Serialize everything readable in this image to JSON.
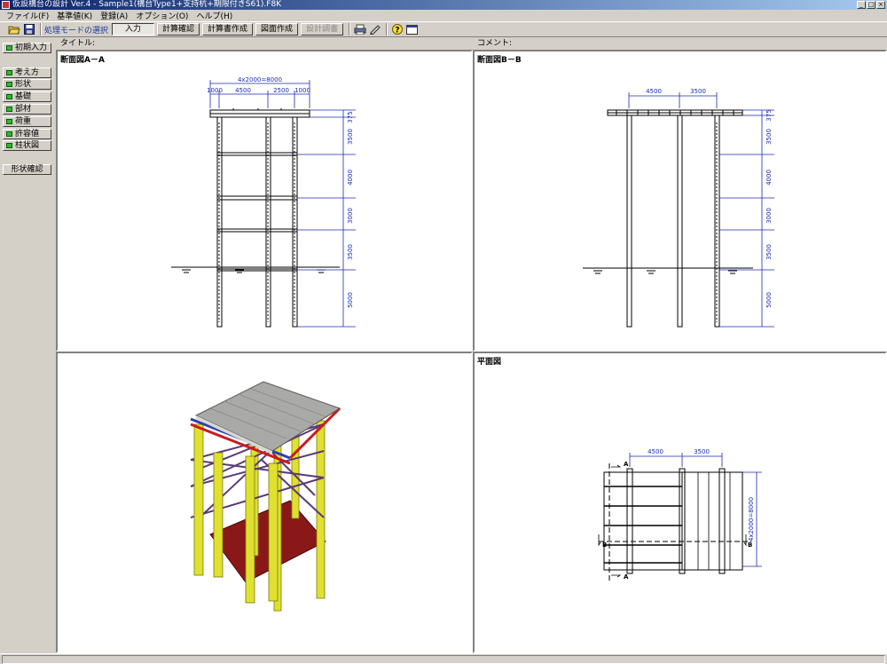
{
  "window": {
    "title": "仮設構台の設計 Ver.4 - Sample1(構台Type1+支持杭+期限付きS61).F8K"
  },
  "menu": [
    "ファイル(F)",
    "基準値(K)",
    "登録(A)",
    "オプション(O)",
    "ヘルプ(H)"
  ],
  "toolbar": {
    "mode_label": "処理モードの選択",
    "buttons": [
      "入力",
      "計算確認",
      "計算書作成",
      "図面作成",
      "設計調書"
    ],
    "active": "入力",
    "disabled": "設計調書"
  },
  "sidebar": {
    "top": "初期入力",
    "items": [
      "考え方",
      "形状",
      "基礎",
      "部材",
      "荷重",
      "許容値",
      "柱状図"
    ],
    "check": "形状確認"
  },
  "header": {
    "title_label": "タイトル:",
    "comment_label": "コメント:"
  },
  "panes": {
    "section_aa": {
      "label": "断面図A－A",
      "dims_top": {
        "total": "4x2000=8000",
        "parts": [
          "1000",
          "4500",
          "2500",
          "1000"
        ]
      },
      "dims_side": [
        "375",
        "3500",
        "4000",
        "3000",
        "3500",
        "5000"
      ]
    },
    "section_bb": {
      "label": "断面図B－B",
      "dims_top": [
        "4500",
        "3500"
      ],
      "dims_side": [
        "375",
        "3500",
        "4000",
        "3000",
        "3500",
        "5000"
      ]
    },
    "plan": {
      "label": "平面図",
      "dims_top": [
        "4500",
        "3500"
      ],
      "dim_side": "4x2000=8000",
      "markers": {
        "a": "A",
        "b": "B"
      }
    }
  },
  "colors": {
    "deck": "#a9aaa8",
    "pile": "#e0e030",
    "beam_red": "#cc1a1a",
    "beam_blue": "#2d3fb0",
    "brace": "#5a3a78",
    "ground": "#8a1818",
    "dim": "#1a2ab0"
  }
}
